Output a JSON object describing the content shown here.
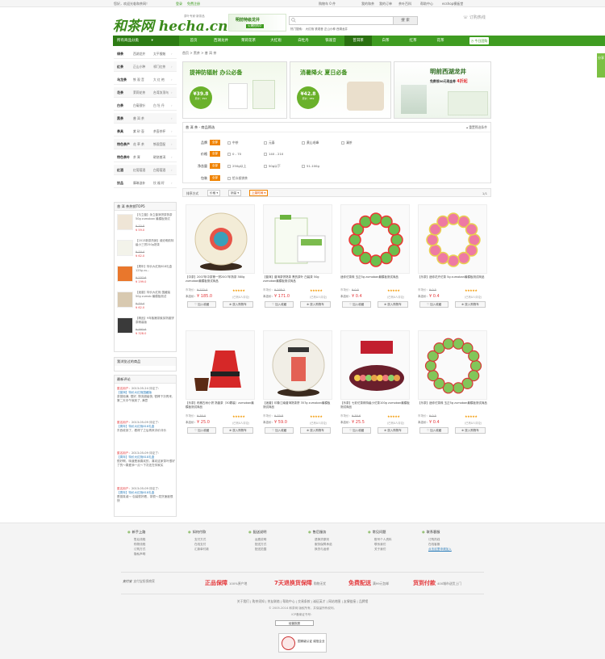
{
  "topbar": {
    "welcome": "您好，欢迎光临和茶网！",
    "login": "登录",
    "register": "免费注册",
    "links": [
      "我的和茶",
      "我的订单",
      "茶叶百科",
      "帮助中心",
      "ecshop模板堂"
    ],
    "cart": "购物车 0 件"
  },
  "header": {
    "logo": "和茶网 hecha.cn",
    "logo_sub": "茶叶专家·新茶品",
    "promo_line1": "明前特级龙井",
    "promo_line2": "火爆抢购中",
    "search_placeholder": "",
    "search_button": "搜 索",
    "hotwords": "热门搜索： 大红袍  铁观音  正山小种  西湖龙井",
    "hotline": "订购热线"
  },
  "nav": {
    "category_label": "所有商品分类",
    "items": [
      "首页",
      "西湖龙井",
      "茉莉花茶",
      "大红袍",
      "白牡丹",
      "铁观音",
      "普洱茶",
      "白茶",
      "红茶",
      "花茶"
    ],
    "active_index": 6,
    "today": "今日团购",
    "side_tab": "分享"
  },
  "sidebar": {
    "categories": [
      {
        "name": "绿茶",
        "a": "西湖龙井",
        "b": "太平猴魁"
      },
      {
        "name": "红茶",
        "a": "正山小种",
        "b": "祁门红茶"
      },
      {
        "name": "乌龙茶",
        "a": "铁 观 音",
        "b": "大 红 袍"
      },
      {
        "name": "花茶",
        "a": "茉莉花茶",
        "b": "台湾冻顶乌"
      },
      {
        "name": "白茶",
        "a": "白毫银针",
        "b": "白 牡 丹"
      },
      {
        "name": "黑茶",
        "a": "普 洱 茶",
        "b": ""
      },
      {
        "name": "茶具",
        "a": "紫 砂 壶",
        "b": "茶壶茶杯"
      },
      {
        "name": "特色茶产",
        "a": "花 草 茶",
        "b": "铁观音配"
      },
      {
        "name": "特色茶叶",
        "a": "茶 膏",
        "b": "碳烧普洱"
      },
      {
        "name": "红酒",
        "a": "红葡萄酒",
        "b": "白葡萄酒"
      },
      {
        "name": "饮品",
        "a": "摩琳滋补",
        "b": "饮 福 籽"
      }
    ],
    "top5_title": "普 洱 茶热销TOP5",
    "top5": [
      {
        "name": "【与立普】永立普洱饼茶熟茶50g zumoban 最模板测试",
        "op": "¥ 70.8",
        "np": "¥ 59.0"
      },
      {
        "name": "【2013新茶热销】澜沧明前特级小三饼250g熟茶",
        "op": "¥ 74.4",
        "np": "¥ 62.0"
      },
      {
        "name": "【周年】特价大红袍618礼盒 125g zu...",
        "op": "¥ 237.6",
        "np": "¥ 199.0"
      },
      {
        "name": "【迷普】特价大红袍 国藏装50g zumob 最模板测试",
        "op": "¥ 74.4",
        "np": "¥ 62.0"
      },
      {
        "name": "【精品】9年紫嫩茶紫芽熟普饼茶精装版",
        "op": "¥ 393.6",
        "np": "¥ 328.0"
      }
    ],
    "viewed_title": "我浏览过的商品",
    "reviews_title": "最新评论",
    "reviews": [
      {
        "user": "匿名用户：",
        "date": "2013-05-24",
        "action": "评论了：",
        "product": "【普洱】特价大红袍国藏版",
        "text": "茶挺饱满, 很好, 物流超级快, 很棒下次再来, 第二天中午就到了, 满意"
      },
      {
        "user": "匿名用户：",
        "date": "2013-05-09",
        "action": "评论了：",
        "product": "【周年】特价大红袍618礼盒",
        "text": "东西收到了，看得了之后再来评价评价"
      },
      {
        "user": "匿名用户：",
        "date": "2013-05-09",
        "action": "评论了：",
        "product": "【周年】特价大红袍618礼盒",
        "text": "很好啊，味道是我喜欢的，喜欢这家茶叶很好了的～喜爱添一点～下次还在你家买"
      },
      {
        "user": "匿名用户：",
        "date": "2013-05-09",
        "action": "评论了：",
        "product": "【周年】特价大红袍618礼盒",
        "text": "是挺真诚～ 包装很好看，茶很～发货速度很快"
      }
    ]
  },
  "breadcrumb": "首页 > 黑茶 > 普 洱 茶",
  "banners": [
    {
      "title": "提神防辐射 办公必备",
      "price": "¥39.8",
      "old": "原价：¥92"
    },
    {
      "title": "消暑降火 夏日必备",
      "price": "¥42.8",
      "old": "原价：¥89"
    },
    {
      "title": "明前西湖龙井",
      "sub": "免费领30元现金券",
      "discount": "4折起"
    }
  ],
  "filter": {
    "title": "普 洱 茶 - 商品筛选",
    "collapse": "重置筛选条件",
    "all_label": "全部",
    "rows": [
      {
        "label": "品牌",
        "options": [
          "中茶",
          "元泰",
          "黄山毛峰",
          "澜茶"
        ]
      },
      {
        "label": "价格",
        "options": [
          "0 - 70",
          "140 - 210"
        ]
      },
      {
        "label": "净含量",
        "options": [
          "250g以上",
          "50g以下",
          "51-100g"
        ]
      },
      {
        "label": "包装",
        "options": [
          "铝卡纸饼茶"
        ]
      }
    ]
  },
  "sortbar": {
    "label": "排序方式",
    "buttons": [
      "价格",
      "销量",
      "上架时间"
    ],
    "pager": "1/1"
  },
  "products": [
    {
      "name": "【中茶】2007年中茶第一饼2007年熟茶 380g zumoban最模板测试商品",
      "mkt_label": "市场价：",
      "mkt": "¥ 222.0",
      "stars": "★★★★★",
      "our_label": "本店价：",
      "our": "¥ 185.0",
      "cmt": "(已有0人评论)",
      "fav": "加入收藏",
      "cart": "放入购物车",
      "img": "cake"
    },
    {
      "name": "【普洱】普洱茶饼熟茶 黑的茶叶 白装茶 50g zumoban最模板测试商品",
      "mkt_label": "市场价：",
      "mkt": "¥ 205.2",
      "stars": "★★★★★",
      "our_label": "本店价：",
      "our": "¥ 171.0",
      "cmt": "(已有0人评论)",
      "fav": "加入收藏",
      "cart": "放入购物车",
      "img": "box"
    },
    {
      "name": "迷你沱茶珠 玉正5g zumoban最模板测试商品",
      "mkt_label": "市场价：",
      "mkt": "¥ 0.5",
      "stars": "★★★★★",
      "our_label": "本店价：",
      "our": "¥ 0.4",
      "cmt": "(已有0人评论)",
      "fav": "加入收藏",
      "cart": "放入购物车",
      "img": "ring-green"
    },
    {
      "name": "【乐茶】迷你花卉沱茶 5g zumoban最模板测试商品",
      "mkt_label": "市场价：",
      "mkt": "¥ 0.5",
      "stars": "★★★★★",
      "our_label": "本店价：",
      "our": "¥ 0.4",
      "cmt": "(已有0人评论)",
      "fav": "加入收藏",
      "cart": "放入购物车",
      "img": "ring-pink"
    },
    {
      "name": "【乐茶】布朗古树小饼 熟普茶（30颗装）zumoban最模板测试商品",
      "mkt_label": "市场价：",
      "mkt": "¥ 30.0",
      "stars": "★★★★★",
      "our_label": "本店价：",
      "our": "¥ 25.0",
      "cmt": "(已有0人评论)",
      "fav": "加入收藏",
      "cart": "放入购物车",
      "img": "bag"
    },
    {
      "name": "【迷普】印象江南普洱熟茶饼 357g zumoban最模板测试商品",
      "mkt_label": "市场价：",
      "mkt": "¥ 70.8",
      "stars": "★★★★★",
      "our_label": "本店价：",
      "our": "¥ 59.0",
      "cmt": "(已有0人评论)",
      "fav": "加入收藏",
      "cart": "放入购物车",
      "img": "cake2"
    },
    {
      "name": "【乐茶】七彩沱茶珠特级小沱茶100g zumoban最模板测试商品",
      "mkt_label": "市场价：",
      "mkt": "¥ 30.6",
      "stars": "★★★★★",
      "our_label": "本店价：",
      "our": "¥ 25.5",
      "cmt": "(已有0人评论)",
      "fav": "加入收藏",
      "cart": "放入购物车",
      "img": "tin"
    },
    {
      "name": "【乐茶】迷你沱茶珠 玉正5g zumoban最模板测试商品",
      "mkt_label": "市场价：",
      "mkt": "¥ 0.5",
      "stars": "★★★★★",
      "our_label": "本店价：",
      "our": "¥ 0.4",
      "cmt": "(已有0人评论)",
      "fav": "加入收藏",
      "cart": "放入购物车",
      "img": "ring-green2"
    }
  ],
  "footer": {
    "help": [
      {
        "title": "新手上路",
        "links": [
          "售后流程",
          "购物流程",
          "订购方式",
          "隐私声明"
        ]
      },
      {
        "title": "如何付款",
        "links": [
          "支付方式",
          "在线支付",
          "汇款单付款"
        ]
      },
      {
        "title": "配送说明",
        "links": [
          "运费说明",
          "配送方式",
          "配送范围"
        ]
      },
      {
        "title": "售后服务",
        "links": [
          "退换货原则",
          "服务保障承诺",
          "换货与返修"
        ]
      },
      {
        "title": "常见问题",
        "links": [
          "账号个人资料",
          "联系我们",
          "关于我们"
        ]
      },
      {
        "title": "联系客服",
        "links": [
          "订购热线",
          "",
          "在线客服",
          "点击这里申请加入"
        ]
      }
    ],
    "alipay": "支付宝",
    "alipay_text": "支付宝担保商家",
    "guarantees": [
      {
        "big": "正品保障",
        "small": "100%原产地"
      },
      {
        "big": "7天退换货保障",
        "small": "购物无忧"
      },
      {
        "big": "免费配送",
        "small": "满99元包邮"
      },
      {
        "big": "货到付款",
        "small": "400城市送货上门"
      }
    ],
    "links": "关于我们 | 购茶须知 | 茶友联络 | 帮助中心 | 交易条款 | 诚征英才 | 网站地图 | 友情链接 | 品牌馆",
    "copyright": "© 2005-2014 和茶网 版权所有，并保留所有权利。",
    "icp": "ICP备案证书号：",
    "badge": "经营执照",
    "seal": "国家级认证 诚信企业"
  }
}
